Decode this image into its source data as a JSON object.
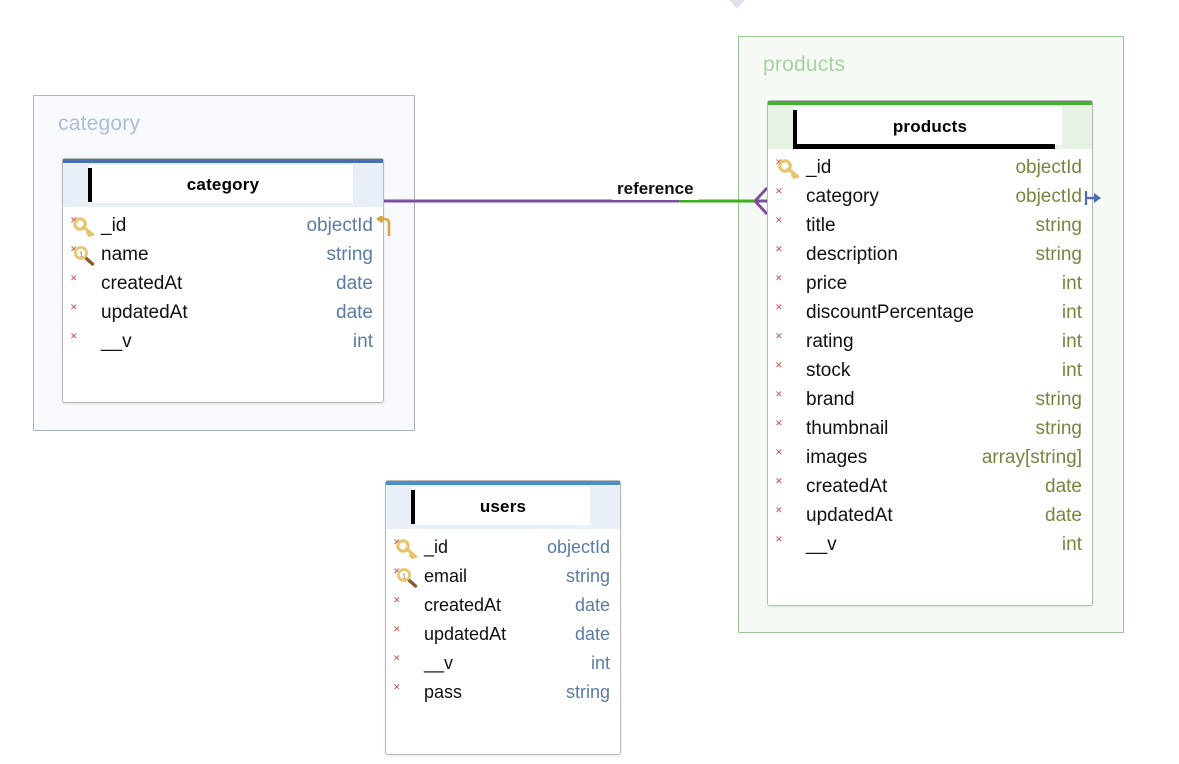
{
  "diagram": {
    "kind": "er-diagram",
    "colors": {
      "category_group_border": "#aab4cc",
      "category_group_bg": "#f7f9fc",
      "category_group_label": "#aebcd6",
      "products_group_border": "#9ec49a",
      "products_group_bg": "#f6faf4",
      "products_group_label": "#a9d1a3",
      "category_accent": "#4a6fae",
      "products_accent": "#4aad3a",
      "users_accent": "#4a8fc4",
      "type_blue": "#5c7ba6",
      "type_olive": "#78853f",
      "required_star": "#c0504d",
      "edge_purple": "#7c4fa0",
      "edge_green": "#3fae1f",
      "key_gold": "#e8c46a",
      "key_brown": "#8a5a2b",
      "fk_arrow_blue": "#4a6fae",
      "hook_gold": "#d9a441"
    }
  },
  "groups": {
    "category": {
      "label": "category"
    },
    "products": {
      "label": "products"
    }
  },
  "relationship": {
    "label": "reference",
    "from_table": "category",
    "to_table": "products",
    "to_field": "category"
  },
  "tables": {
    "category": {
      "title": "category",
      "editing": false,
      "fields": [
        {
          "name": "_id",
          "type": "objectId",
          "key": "primary",
          "required": true,
          "hook": true
        },
        {
          "name": "name",
          "type": "string",
          "key": "unique",
          "required": true,
          "hook": false
        },
        {
          "name": "createdAt",
          "type": "date",
          "key": "none",
          "required": true,
          "hook": false
        },
        {
          "name": "updatedAt",
          "type": "date",
          "key": "none",
          "required": true,
          "hook": false
        },
        {
          "name": "__v",
          "type": "int",
          "key": "none",
          "required": true,
          "hook": false
        }
      ]
    },
    "products": {
      "title": "products",
      "editing": true,
      "fields": [
        {
          "name": "_id",
          "type": "objectId",
          "key": "primary",
          "required": true,
          "fk": false
        },
        {
          "name": "category",
          "type": "objectId",
          "key": "none",
          "required": true,
          "fk": true
        },
        {
          "name": "title",
          "type": "string",
          "key": "none",
          "required": true,
          "fk": false
        },
        {
          "name": "description",
          "type": "string",
          "key": "none",
          "required": true,
          "fk": false
        },
        {
          "name": "price",
          "type": "int",
          "key": "none",
          "required": true,
          "fk": false
        },
        {
          "name": "discountPercentage",
          "type": "int",
          "key": "none",
          "required": true,
          "fk": false
        },
        {
          "name": "rating",
          "type": "int",
          "key": "none",
          "required": true,
          "fk": false
        },
        {
          "name": "stock",
          "type": "int",
          "key": "none",
          "required": true,
          "fk": false
        },
        {
          "name": "brand",
          "type": "string",
          "key": "none",
          "required": true,
          "fk": false
        },
        {
          "name": "thumbnail",
          "type": "string",
          "key": "none",
          "required": true,
          "fk": false
        },
        {
          "name": "images",
          "type": "array[string]",
          "key": "none",
          "required": true,
          "fk": false
        },
        {
          "name": "createdAt",
          "type": "date",
          "key": "none",
          "required": true,
          "fk": false
        },
        {
          "name": "updatedAt",
          "type": "date",
          "key": "none",
          "required": true,
          "fk": false
        },
        {
          "name": "__v",
          "type": "int",
          "key": "none",
          "required": true,
          "fk": false
        }
      ]
    },
    "users": {
      "title": "users",
      "editing": false,
      "fields": [
        {
          "name": "_id",
          "type": "objectId",
          "key": "primary",
          "required": true
        },
        {
          "name": "email",
          "type": "string",
          "key": "unique",
          "required": true
        },
        {
          "name": "createdAt",
          "type": "date",
          "key": "none",
          "required": true
        },
        {
          "name": "updatedAt",
          "type": "date",
          "key": "none",
          "required": true
        },
        {
          "name": "__v",
          "type": "int",
          "key": "none",
          "required": true
        },
        {
          "name": "pass",
          "type": "string",
          "key": "none",
          "required": true
        }
      ]
    }
  }
}
